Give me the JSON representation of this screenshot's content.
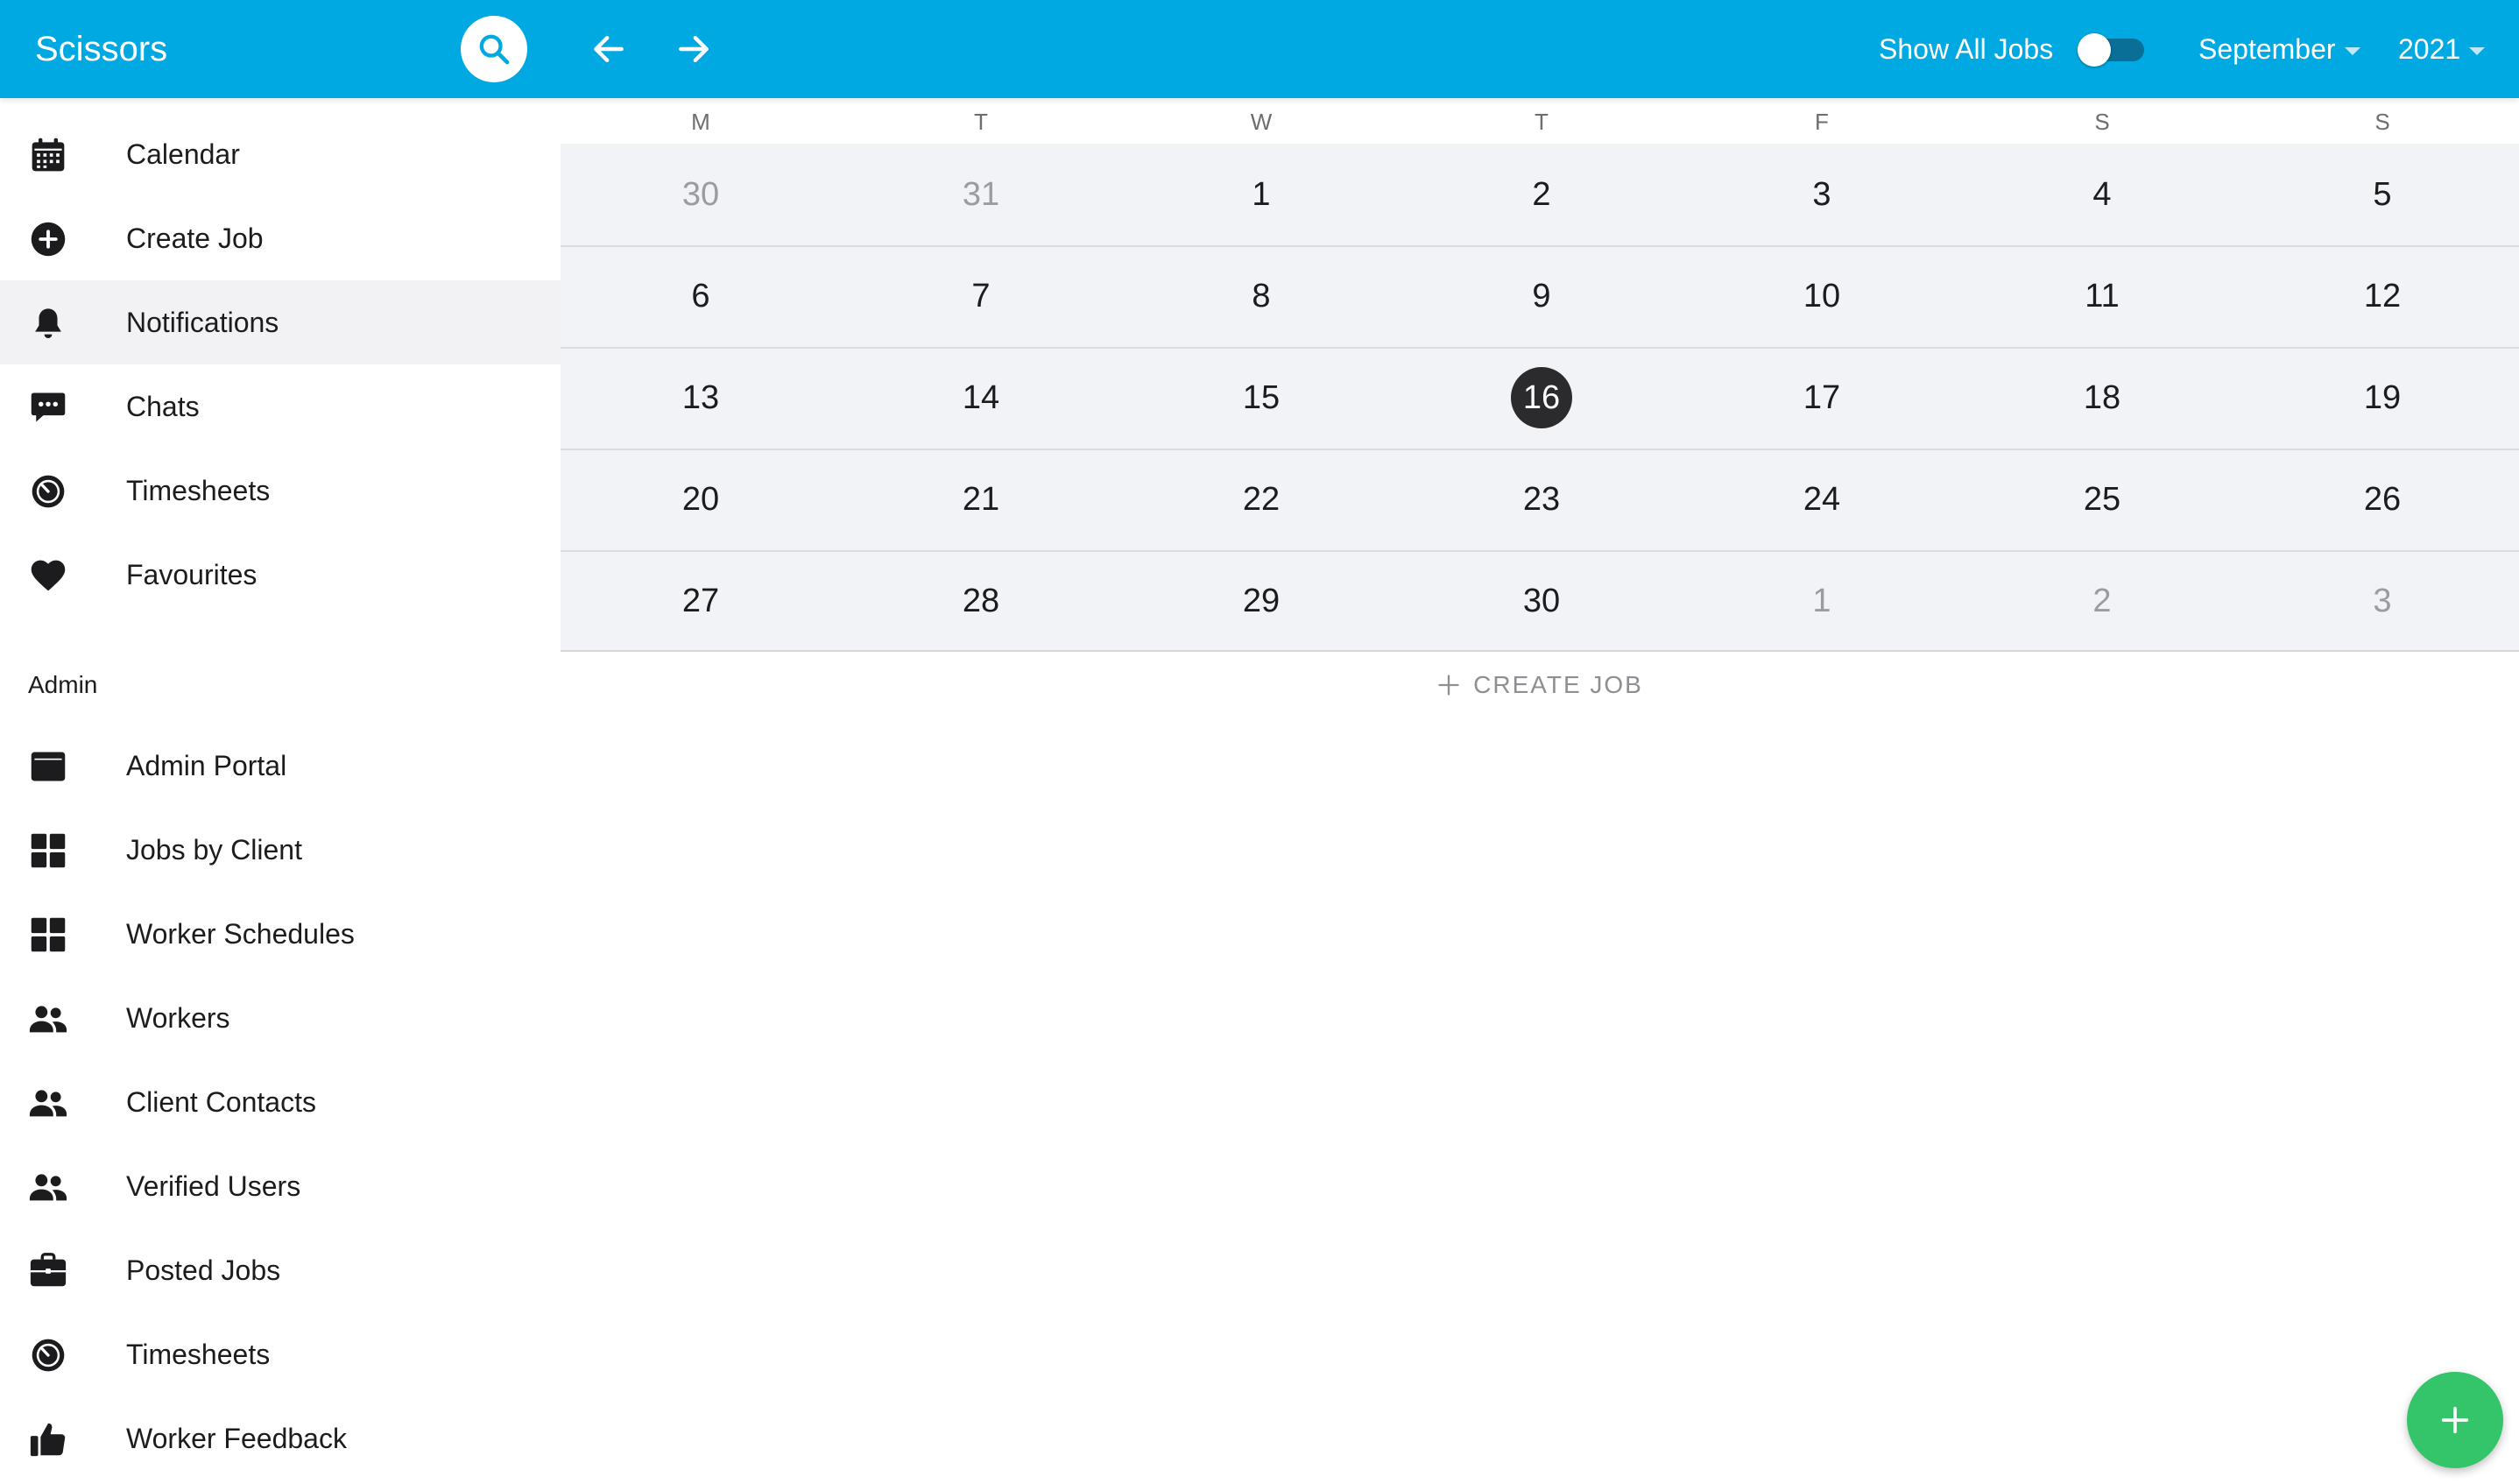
{
  "app": {
    "title": "Scissors"
  },
  "header": {
    "show_all_jobs_label": "Show All Jobs",
    "show_all_jobs_on": false,
    "month": "September",
    "year": "2021"
  },
  "sidebar": {
    "items": [
      {
        "label": "Calendar",
        "icon": "calendar-icon"
      },
      {
        "label": "Create Job",
        "icon": "plus-circle-icon"
      },
      {
        "label": "Notifications",
        "icon": "bell-icon",
        "active": true
      },
      {
        "label": "Chats",
        "icon": "chat-bubble-icon"
      },
      {
        "label": "Timesheets",
        "icon": "stopwatch-icon"
      },
      {
        "label": "Favourites",
        "icon": "heart-icon"
      }
    ],
    "admin_section_label": "Admin",
    "admin_items": [
      {
        "label": "Admin Portal",
        "icon": "window-icon"
      },
      {
        "label": "Jobs by Client",
        "icon": "grid-icon"
      },
      {
        "label": "Worker Schedules",
        "icon": "grid-icon"
      },
      {
        "label": "Workers",
        "icon": "people-icon"
      },
      {
        "label": "Client Contacts",
        "icon": "people-icon"
      },
      {
        "label": "Verified Users",
        "icon": "people-icon"
      },
      {
        "label": "Posted Jobs",
        "icon": "briefcase-icon"
      },
      {
        "label": "Timesheets",
        "icon": "stopwatch-icon"
      },
      {
        "label": "Worker Feedback",
        "icon": "thumbs-up-icon"
      }
    ]
  },
  "calendar": {
    "weekdays": [
      "M",
      "T",
      "W",
      "T",
      "F",
      "S",
      "S"
    ],
    "weeks": [
      [
        "30",
        "31",
        "1",
        "2",
        "3",
        "4",
        "5"
      ],
      [
        "6",
        "7",
        "8",
        "9",
        "10",
        "11",
        "12"
      ],
      [
        "13",
        "14",
        "15",
        "16",
        "17",
        "18",
        "19"
      ],
      [
        "20",
        "21",
        "22",
        "23",
        "24",
        "25",
        "26"
      ],
      [
        "27",
        "28",
        "29",
        "30",
        "1",
        "2",
        "3"
      ]
    ],
    "today": "16",
    "create_job_label": "CREATE JOB"
  },
  "colors": {
    "header": "#00a9e2",
    "today_bg": "#2b2b2e",
    "fab": "#34c46a",
    "grid_bg": "#f2f3f7"
  }
}
